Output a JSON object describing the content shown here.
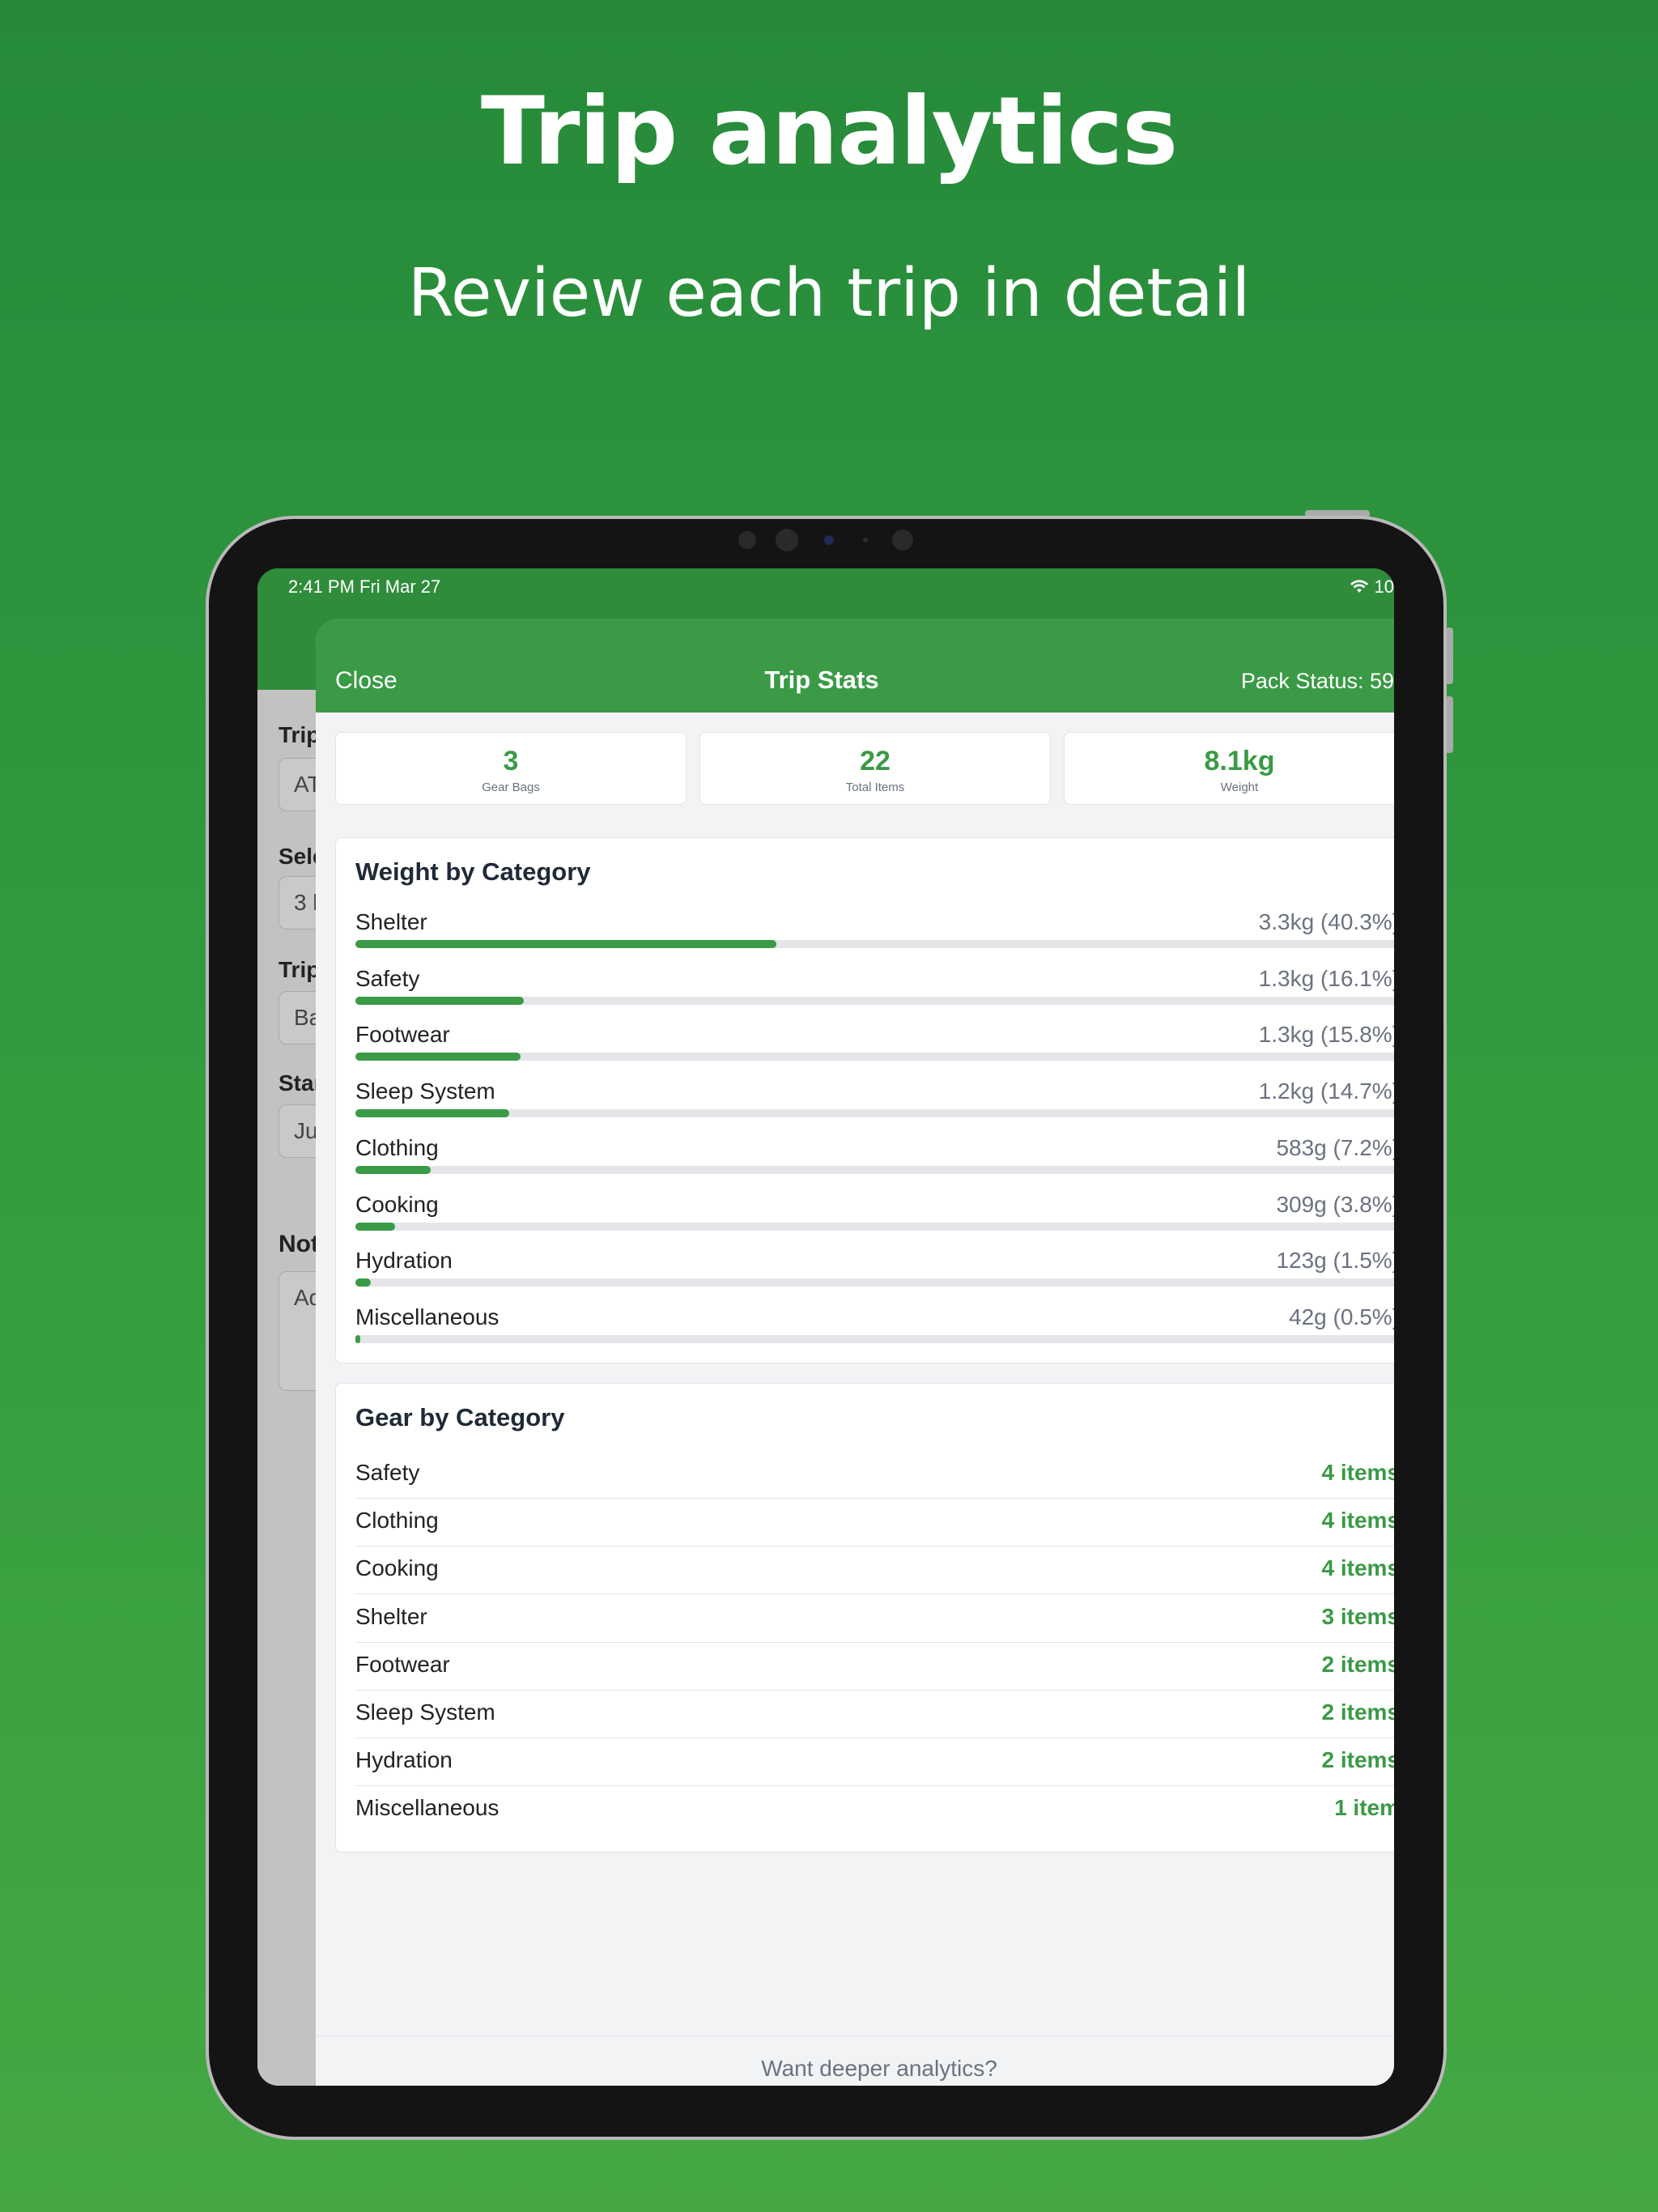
{
  "marketing": {
    "headline": "Trip analytics",
    "subheadline": "Review each trip in detail"
  },
  "status_bar": {
    "time": "2:41 PM   Fri Mar 27",
    "wifi_icon": "wifi-icon",
    "battery_text": "10"
  },
  "background_form": {
    "labels": [
      "Trip",
      "Sele",
      "Trip",
      "Star",
      "Not"
    ],
    "fields": [
      "AT",
      "3 l",
      "Ba",
      "Ju",
      "Ad"
    ]
  },
  "sheet": {
    "nav": {
      "close_label": "Close",
      "title": "Trip Stats",
      "pack_status": "Pack Status: 59"
    },
    "stats": [
      {
        "value": "3",
        "label": "Gear Bags"
      },
      {
        "value": "22",
        "label": "Total Items"
      },
      {
        "value": "8.1kg",
        "label": "Weight"
      }
    ],
    "weight_by_category": {
      "title": "Weight by Category",
      "rows": [
        {
          "name": "Shelter",
          "value": "3.3kg (40.3%)",
          "percent": 40.3
        },
        {
          "name": "Safety",
          "value": "1.3kg (16.1%)",
          "percent": 16.1
        },
        {
          "name": "Footwear",
          "value": "1.3kg (15.8%)",
          "percent": 15.8
        },
        {
          "name": "Sleep System",
          "value": "1.2kg (14.7%)",
          "percent": 14.7
        },
        {
          "name": "Clothing",
          "value": "583g (7.2%)",
          "percent": 7.2
        },
        {
          "name": "Cooking",
          "value": "309g (3.8%)",
          "percent": 3.8
        },
        {
          "name": "Hydration",
          "value": "123g (1.5%)",
          "percent": 1.5
        },
        {
          "name": "Miscellaneous",
          "value": "42g (0.5%)",
          "percent": 0.5
        }
      ]
    },
    "gear_by_category": {
      "title": "Gear by Category",
      "rows": [
        {
          "name": "Safety",
          "count": "4 items"
        },
        {
          "name": "Clothing",
          "count": "4 items"
        },
        {
          "name": "Cooking",
          "count": "4 items"
        },
        {
          "name": "Shelter",
          "count": "3 items"
        },
        {
          "name": "Footwear",
          "count": "2 items"
        },
        {
          "name": "Sleep System",
          "count": "2 items"
        },
        {
          "name": "Hydration",
          "count": "2 items"
        },
        {
          "name": "Miscellaneous",
          "count": "1 item"
        }
      ]
    },
    "footer_text": "Want deeper analytics?"
  },
  "colors": {
    "accent": "#3a9a45",
    "nav": "#3a9a45",
    "background_top": "#268a3a",
    "background_bottom": "#45a844"
  }
}
